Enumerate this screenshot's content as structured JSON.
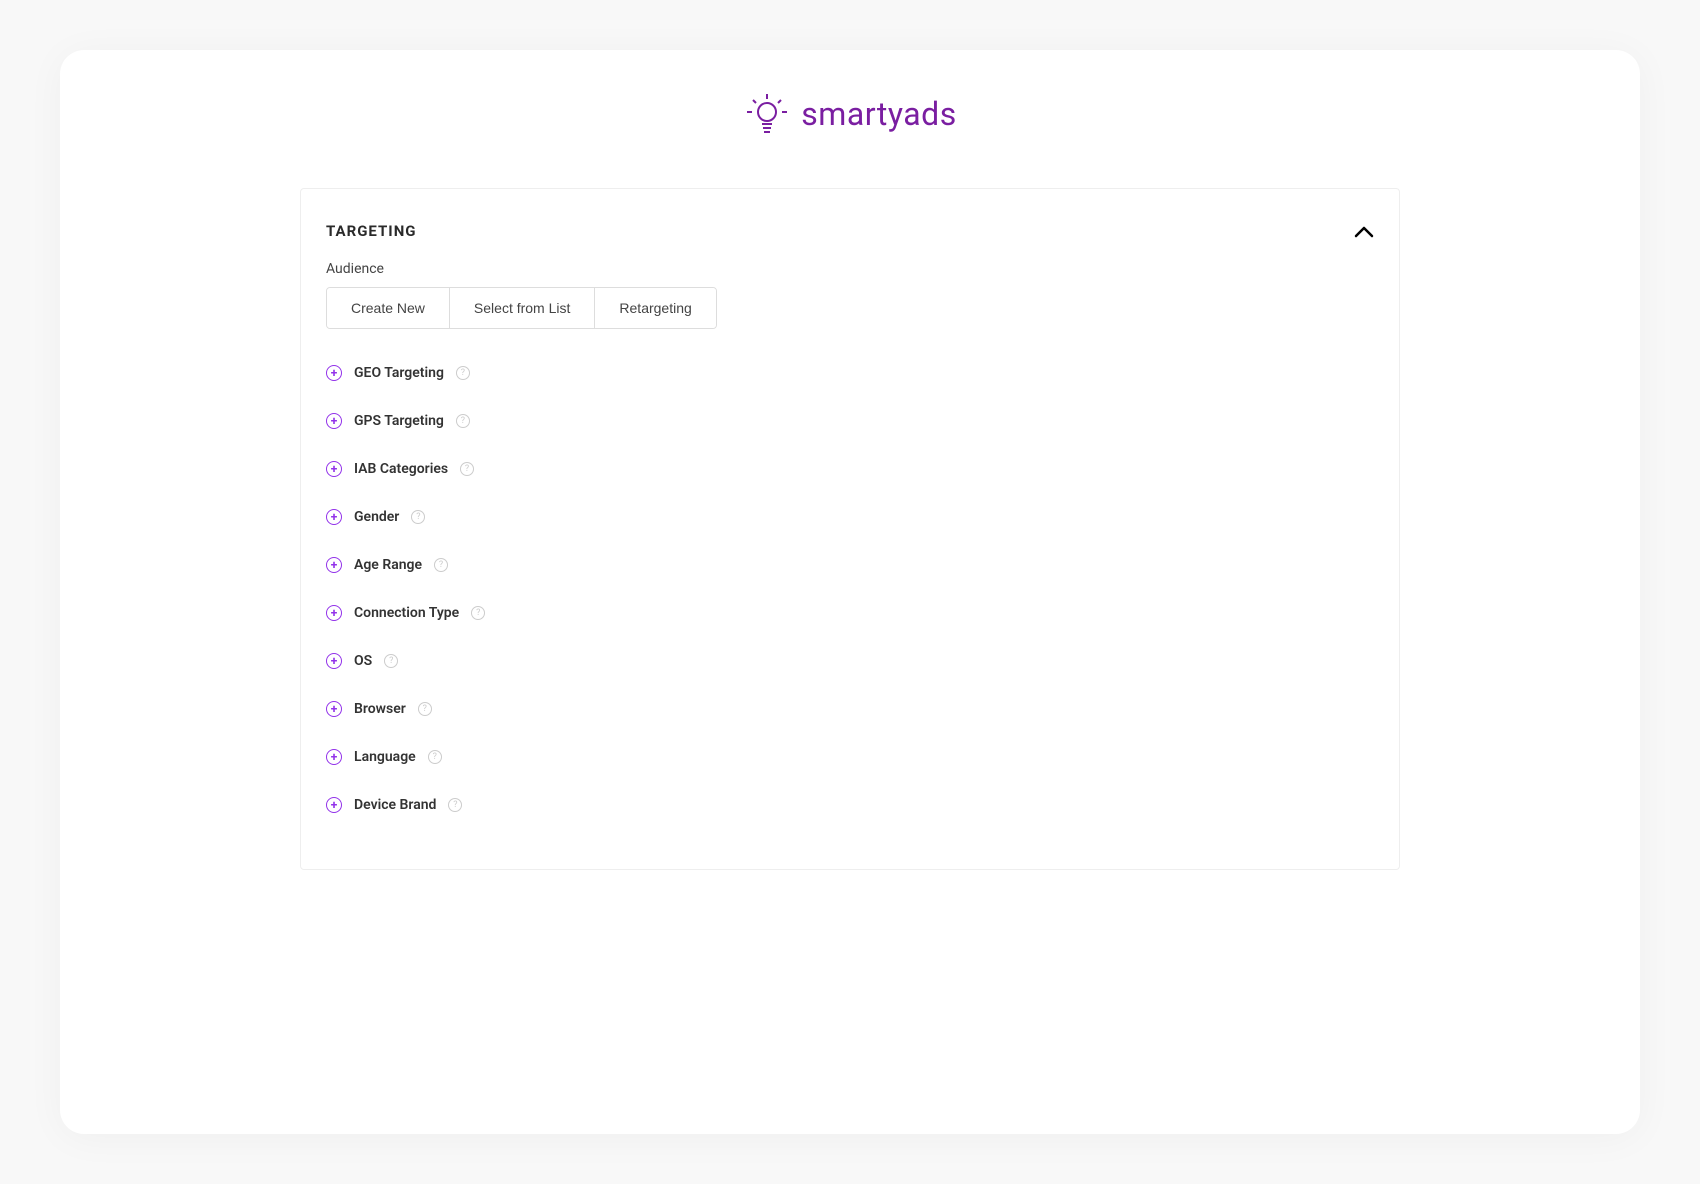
{
  "brand": {
    "name": "smartyads",
    "color": "#7a1ea1"
  },
  "panel": {
    "title": "TARGETING",
    "audience_label": "Audience",
    "buttons": {
      "create_new": "Create New",
      "select_from_list": "Select from List",
      "retargeting": "Retargeting"
    },
    "items": [
      {
        "label": "GEO Targeting"
      },
      {
        "label": "GPS Targeting"
      },
      {
        "label": "IAB Categories"
      },
      {
        "label": "Gender"
      },
      {
        "label": "Age Range"
      },
      {
        "label": "Connection Type"
      },
      {
        "label": "OS"
      },
      {
        "label": "Browser"
      },
      {
        "label": "Language"
      },
      {
        "label": "Device Brand"
      }
    ]
  }
}
